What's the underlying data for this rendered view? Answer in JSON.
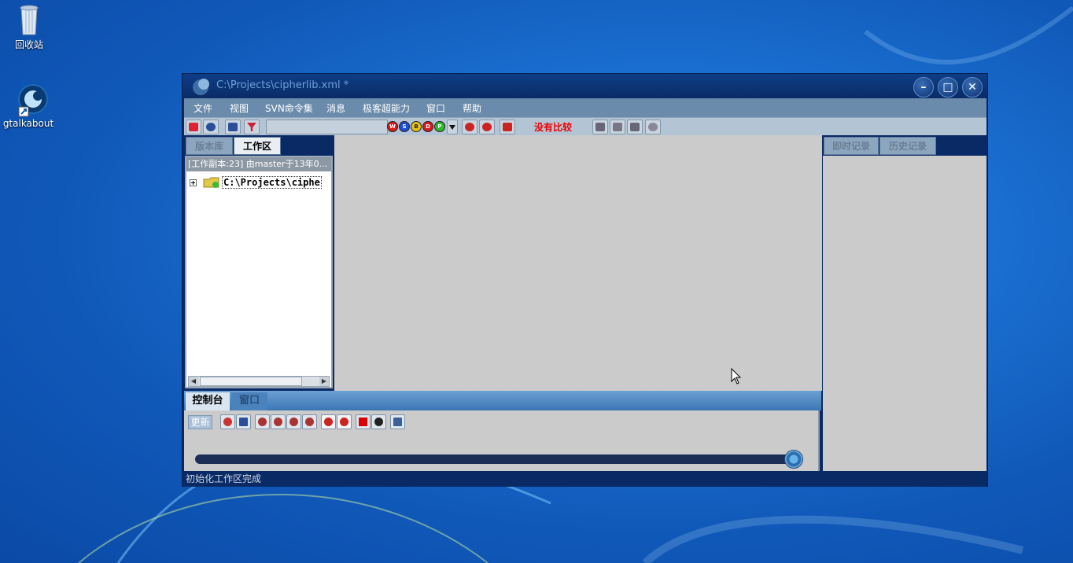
{
  "desktop": {
    "icons": [
      {
        "label": "回收站",
        "icon": "recycle-bin-icon"
      },
      {
        "label": "gtalkabout",
        "icon": "gtalkabout-shortcut-icon"
      }
    ]
  },
  "window": {
    "title": "C:\\Projects\\cipherlib.xml *",
    "controls": {
      "minimize": "–",
      "maximize": "□",
      "close": "✕"
    }
  },
  "menu": [
    "文件",
    "视图",
    "SVN命令集",
    "消息",
    "极客超能力",
    "窗口",
    "帮助"
  ],
  "toolbar": {
    "compare_status": "没有比较",
    "combo_value": "",
    "letter_buttons": [
      "W",
      "S",
      "B",
      "D",
      "P"
    ]
  },
  "left_panel": {
    "tabs": [
      "版本库",
      "工作区"
    ],
    "active_tab": "工作区",
    "working_copy_header": "[工作副本:23] 由master于13年0...",
    "tree_root": "C:\\Projects\\ciphe"
  },
  "right_panel": {
    "tabs": [
      "即时记录",
      "历史记录"
    ]
  },
  "bottom_panel": {
    "tabs": [
      "控制台",
      "窗口"
    ],
    "active_tab": "控制台",
    "refresh_label": "更新",
    "slider_level": 1.0
  },
  "status": "初始化工作区完成",
  "colors": {
    "window_bg": "#0a2a66",
    "menu_bg": "#6a8bab",
    "toolbar_bg": "#b3c4d4",
    "panel_bg": "#cbcbcb",
    "compare_text": "#ee0000"
  }
}
